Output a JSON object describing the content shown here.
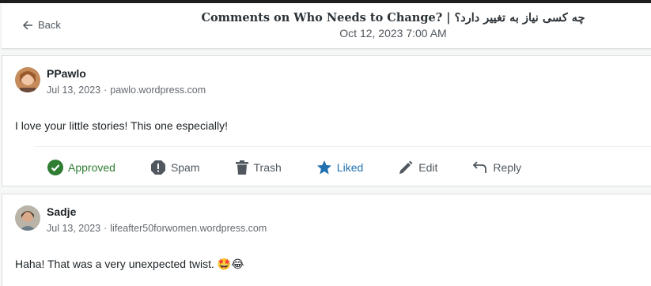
{
  "header": {
    "back_label": "Back",
    "title": "Comments on Who Needs to Change? | چه کسی نیاز به تغییر دارد؟",
    "subtitle": "Oct 12, 2023 7:00 AM"
  },
  "comments": [
    {
      "author": "PPawlo",
      "date": "Jul 13, 2023",
      "site": "pawlo.wordpress.com",
      "text": "I love your little stories! This one especially!",
      "actions": {
        "approved": "Approved",
        "spam": "Spam",
        "trash": "Trash",
        "liked": "Liked",
        "edit": "Edit",
        "reply": "Reply"
      }
    },
    {
      "author": "Sadje",
      "date": "Jul 13, 2023",
      "site": "lifeafter50forwomen.wordpress.com",
      "text": "Haha! That was a very unexpected twist.",
      "emoji": "🤩😂"
    }
  ],
  "colors": {
    "approved": "#2e7d32",
    "liked": "#2271b1",
    "muted": "#50575e"
  }
}
